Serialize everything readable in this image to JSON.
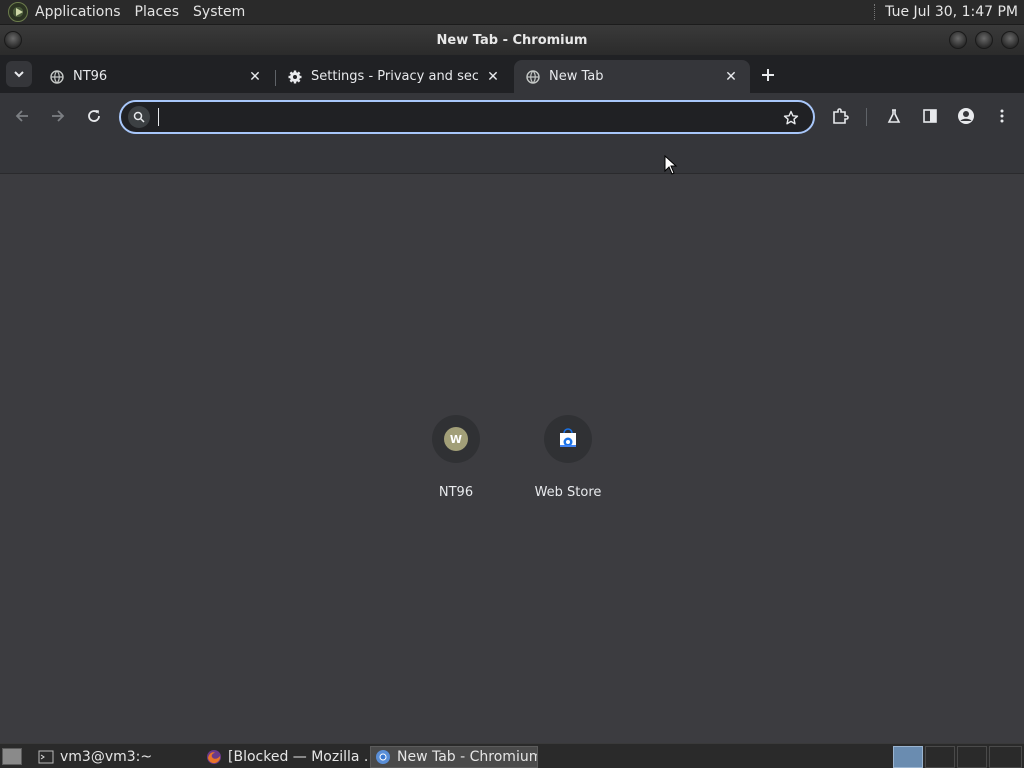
{
  "top_panel": {
    "menus": [
      "Applications",
      "Places",
      "System"
    ],
    "clock": "Tue Jul 30,  1:47 PM"
  },
  "window": {
    "title": "New Tab - Chromium"
  },
  "tabs": [
    {
      "title": "NT96",
      "icon": "globe-icon"
    },
    {
      "title": "Settings - Privacy and security",
      "icon": "gear-icon"
    },
    {
      "title": "New Tab",
      "icon": "globe-icon",
      "active": true
    }
  ],
  "omnibox": {
    "value": "",
    "placeholder": ""
  },
  "shortcuts": [
    {
      "label": "NT96",
      "badge": "W"
    },
    {
      "label": "Web Store"
    }
  ],
  "taskbar": [
    {
      "label": "vm3@vm3:~",
      "icon": "terminal-icon"
    },
    {
      "label": "[Blocked — Mozilla ...",
      "icon": "firefox-icon"
    },
    {
      "label": "New Tab - Chromium",
      "icon": "chromium-icon",
      "active": true
    }
  ],
  "colors": {
    "accent": "#a8c7fa",
    "tab_bg": "#202124",
    "toolbar_bg": "#35363a",
    "content_bg": "#3c3c40"
  }
}
